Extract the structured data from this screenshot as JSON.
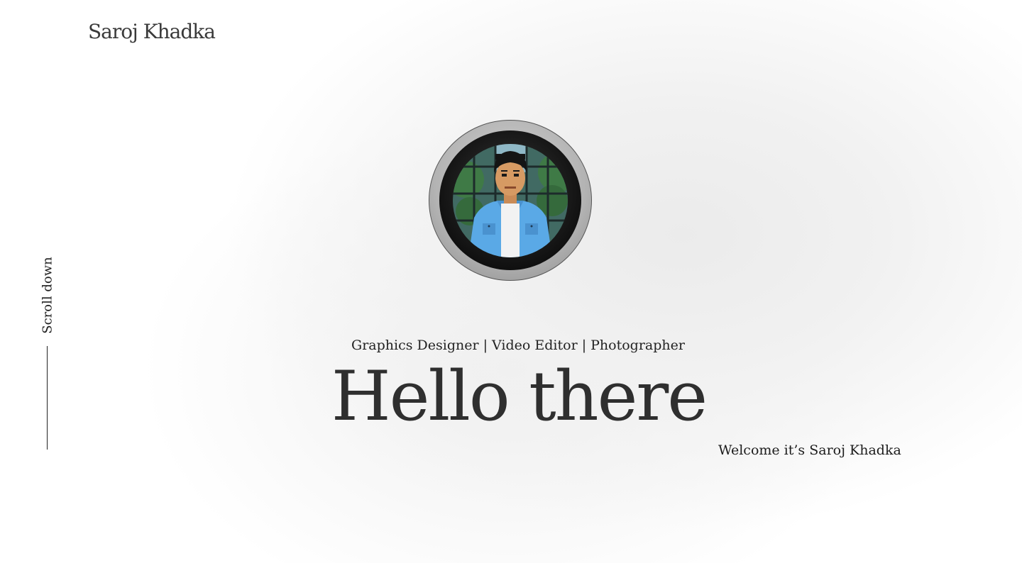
{
  "header": {
    "logo_text": "Saroj Khadka"
  },
  "sidebar": {
    "scroll_label": "Scroll down"
  },
  "hero": {
    "avatar_alt": "Pixel art portrait",
    "roles": "Graphics Designer | Video Editor | Photographer",
    "title": "Hello there",
    "welcome": "Welcome it’s Saroj Khadka"
  },
  "colors": {
    "text_primary": "#2f2f2f",
    "background": "#ffffff",
    "shirt": "#5aa9e6",
    "ring": "#b3b3b3"
  }
}
